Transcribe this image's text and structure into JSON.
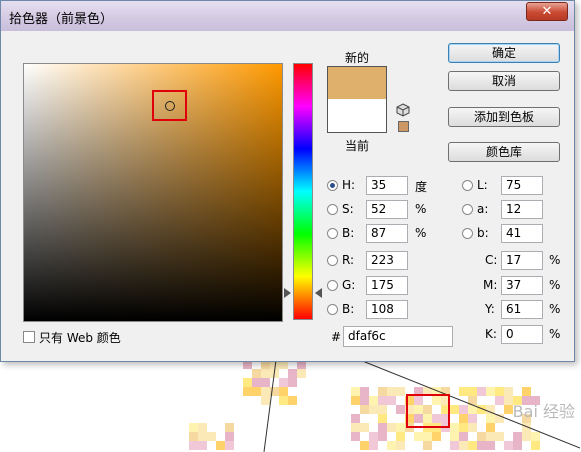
{
  "window": {
    "title": "拾色器（前景色）",
    "close_symbol": "✕"
  },
  "buttons": {
    "ok": "确定",
    "cancel": "取消",
    "add_to_swatches": "添加到色板",
    "color_libraries": "颜色库"
  },
  "swatches": {
    "new_label": "新的",
    "current_label": "当前",
    "new_color": "#dfaf6c",
    "current_color": "#ffffff"
  },
  "hsb": {
    "h": {
      "label": "H:",
      "value": "35",
      "unit": "度",
      "selected": true
    },
    "s": {
      "label": "S:",
      "value": "52",
      "unit": "%"
    },
    "b": {
      "label": "B:",
      "value": "87",
      "unit": "%"
    }
  },
  "rgb": {
    "r": {
      "label": "R:",
      "value": "223"
    },
    "g": {
      "label": "G:",
      "value": "175"
    },
    "b": {
      "label": "B:",
      "value": "108"
    }
  },
  "lab": {
    "l": {
      "label": "L:",
      "value": "75"
    },
    "a": {
      "label": "a:",
      "value": "12"
    },
    "b": {
      "label": "b:",
      "value": "41"
    }
  },
  "cmyk": {
    "c": {
      "label": "C:",
      "value": "17",
      "unit": "%"
    },
    "m": {
      "label": "M:",
      "value": "37",
      "unit": "%"
    },
    "y": {
      "label": "Y:",
      "value": "61",
      "unit": "%"
    },
    "k": {
      "label": "K:",
      "value": "0",
      "unit": "%"
    }
  },
  "hex": {
    "label": "#",
    "value": "dfaf6c"
  },
  "web_only": {
    "label": "只有 Web 颜色",
    "checked": false
  },
  "watermark": "Bai 经验",
  "colors": {
    "hue_base": "#ff9900",
    "highlight_box": "#e0000a",
    "websafe_swatch": "#cc9966"
  }
}
